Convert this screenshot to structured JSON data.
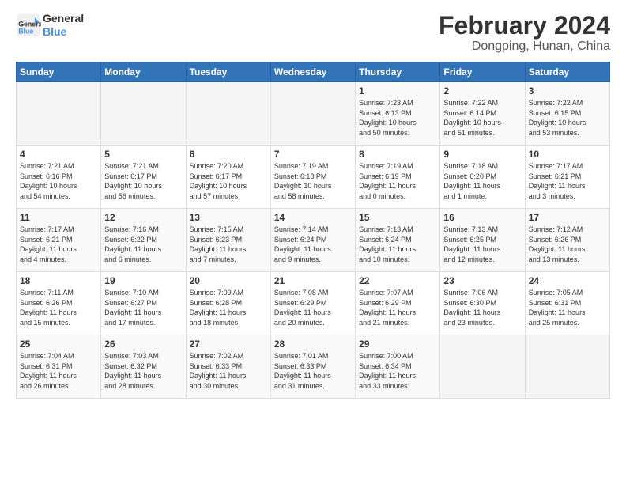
{
  "header": {
    "logo_line1": "General",
    "logo_line2": "Blue",
    "month_year": "February 2024",
    "location": "Dongping, Hunan, China"
  },
  "days_of_week": [
    "Sunday",
    "Monday",
    "Tuesday",
    "Wednesday",
    "Thursday",
    "Friday",
    "Saturday"
  ],
  "weeks": [
    [
      {
        "day": "",
        "info": ""
      },
      {
        "day": "",
        "info": ""
      },
      {
        "day": "",
        "info": ""
      },
      {
        "day": "",
        "info": ""
      },
      {
        "day": "1",
        "info": "Sunrise: 7:23 AM\nSunset: 6:13 PM\nDaylight: 10 hours\nand 50 minutes."
      },
      {
        "day": "2",
        "info": "Sunrise: 7:22 AM\nSunset: 6:14 PM\nDaylight: 10 hours\nand 51 minutes."
      },
      {
        "day": "3",
        "info": "Sunrise: 7:22 AM\nSunset: 6:15 PM\nDaylight: 10 hours\nand 53 minutes."
      }
    ],
    [
      {
        "day": "4",
        "info": "Sunrise: 7:21 AM\nSunset: 6:16 PM\nDaylight: 10 hours\nand 54 minutes."
      },
      {
        "day": "5",
        "info": "Sunrise: 7:21 AM\nSunset: 6:17 PM\nDaylight: 10 hours\nand 56 minutes."
      },
      {
        "day": "6",
        "info": "Sunrise: 7:20 AM\nSunset: 6:17 PM\nDaylight: 10 hours\nand 57 minutes."
      },
      {
        "day": "7",
        "info": "Sunrise: 7:19 AM\nSunset: 6:18 PM\nDaylight: 10 hours\nand 58 minutes."
      },
      {
        "day": "8",
        "info": "Sunrise: 7:19 AM\nSunset: 6:19 PM\nDaylight: 11 hours\nand 0 minutes."
      },
      {
        "day": "9",
        "info": "Sunrise: 7:18 AM\nSunset: 6:20 PM\nDaylight: 11 hours\nand 1 minute."
      },
      {
        "day": "10",
        "info": "Sunrise: 7:17 AM\nSunset: 6:21 PM\nDaylight: 11 hours\nand 3 minutes."
      }
    ],
    [
      {
        "day": "11",
        "info": "Sunrise: 7:17 AM\nSunset: 6:21 PM\nDaylight: 11 hours\nand 4 minutes."
      },
      {
        "day": "12",
        "info": "Sunrise: 7:16 AM\nSunset: 6:22 PM\nDaylight: 11 hours\nand 6 minutes."
      },
      {
        "day": "13",
        "info": "Sunrise: 7:15 AM\nSunset: 6:23 PM\nDaylight: 11 hours\nand 7 minutes."
      },
      {
        "day": "14",
        "info": "Sunrise: 7:14 AM\nSunset: 6:24 PM\nDaylight: 11 hours\nand 9 minutes."
      },
      {
        "day": "15",
        "info": "Sunrise: 7:13 AM\nSunset: 6:24 PM\nDaylight: 11 hours\nand 10 minutes."
      },
      {
        "day": "16",
        "info": "Sunrise: 7:13 AM\nSunset: 6:25 PM\nDaylight: 11 hours\nand 12 minutes."
      },
      {
        "day": "17",
        "info": "Sunrise: 7:12 AM\nSunset: 6:26 PM\nDaylight: 11 hours\nand 13 minutes."
      }
    ],
    [
      {
        "day": "18",
        "info": "Sunrise: 7:11 AM\nSunset: 6:26 PM\nDaylight: 11 hours\nand 15 minutes."
      },
      {
        "day": "19",
        "info": "Sunrise: 7:10 AM\nSunset: 6:27 PM\nDaylight: 11 hours\nand 17 minutes."
      },
      {
        "day": "20",
        "info": "Sunrise: 7:09 AM\nSunset: 6:28 PM\nDaylight: 11 hours\nand 18 minutes."
      },
      {
        "day": "21",
        "info": "Sunrise: 7:08 AM\nSunset: 6:29 PM\nDaylight: 11 hours\nand 20 minutes."
      },
      {
        "day": "22",
        "info": "Sunrise: 7:07 AM\nSunset: 6:29 PM\nDaylight: 11 hours\nand 21 minutes."
      },
      {
        "day": "23",
        "info": "Sunrise: 7:06 AM\nSunset: 6:30 PM\nDaylight: 11 hours\nand 23 minutes."
      },
      {
        "day": "24",
        "info": "Sunrise: 7:05 AM\nSunset: 6:31 PM\nDaylight: 11 hours\nand 25 minutes."
      }
    ],
    [
      {
        "day": "25",
        "info": "Sunrise: 7:04 AM\nSunset: 6:31 PM\nDaylight: 11 hours\nand 26 minutes."
      },
      {
        "day": "26",
        "info": "Sunrise: 7:03 AM\nSunset: 6:32 PM\nDaylight: 11 hours\nand 28 minutes."
      },
      {
        "day": "27",
        "info": "Sunrise: 7:02 AM\nSunset: 6:33 PM\nDaylight: 11 hours\nand 30 minutes."
      },
      {
        "day": "28",
        "info": "Sunrise: 7:01 AM\nSunset: 6:33 PM\nDaylight: 11 hours\nand 31 minutes."
      },
      {
        "day": "29",
        "info": "Sunrise: 7:00 AM\nSunset: 6:34 PM\nDaylight: 11 hours\nand 33 minutes."
      },
      {
        "day": "",
        "info": ""
      },
      {
        "day": "",
        "info": ""
      }
    ]
  ]
}
